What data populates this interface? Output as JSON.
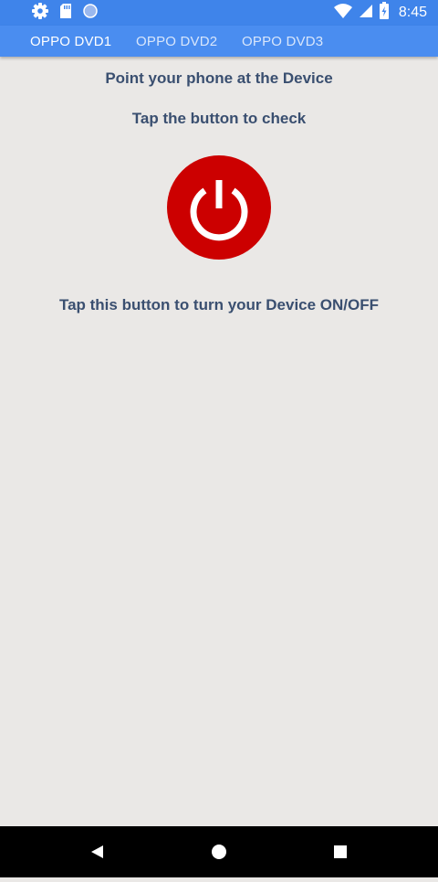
{
  "status_bar": {
    "time": "8:45",
    "left_icons": [
      "gear-icon",
      "sd-card-icon",
      "circle-icon"
    ],
    "right_icons": [
      "wifi-icon",
      "signal-icon",
      "battery-icon"
    ],
    "color": "#3f84ea"
  },
  "tabs": [
    {
      "label": "OPPO DVD1",
      "active": true
    },
    {
      "label": "OPPO DVD2",
      "active": false
    },
    {
      "label": "OPPO DVD3",
      "active": false
    }
  ],
  "main": {
    "instruction_1": "Point your phone at the Device",
    "instruction_2": "Tap the button to check",
    "power_button_icon": "power-icon",
    "power_button_color": "#cc0000",
    "instruction_3": "Tap this button to turn your Device ON/OFF"
  },
  "nav_bar": {
    "buttons": [
      "back-icon",
      "home-icon",
      "recents-icon"
    ]
  }
}
